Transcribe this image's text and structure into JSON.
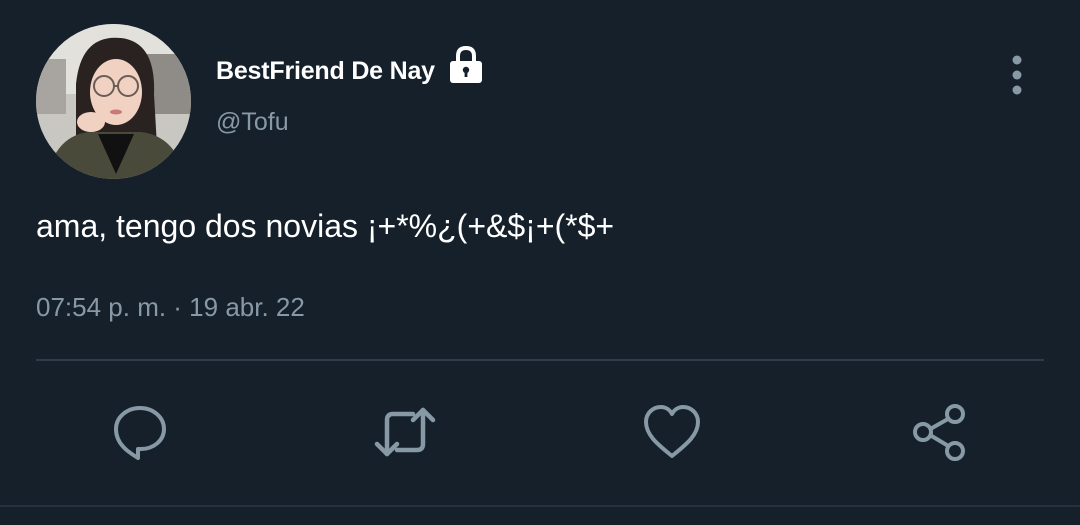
{
  "user": {
    "display_name": "BestFriend De Nay",
    "handle": "@Tofu",
    "protected": true
  },
  "tweet": {
    "text": "ama, tengo dos novias ¡+*%¿(+&$¡+(*$+",
    "timestamp": "07:54 p. m. · 19 abr. 22"
  },
  "icons": {
    "lock": "lock-icon",
    "more": "more-vertical-icon",
    "reply": "reply-icon",
    "retweet": "retweet-icon",
    "like": "heart-icon",
    "share": "share-icon"
  },
  "colors": {
    "background": "#15202b",
    "primary_text": "#ffffff",
    "secondary_text": "#8899a6",
    "divider": "#2f3d4a",
    "action_icon": "#8899a6"
  }
}
